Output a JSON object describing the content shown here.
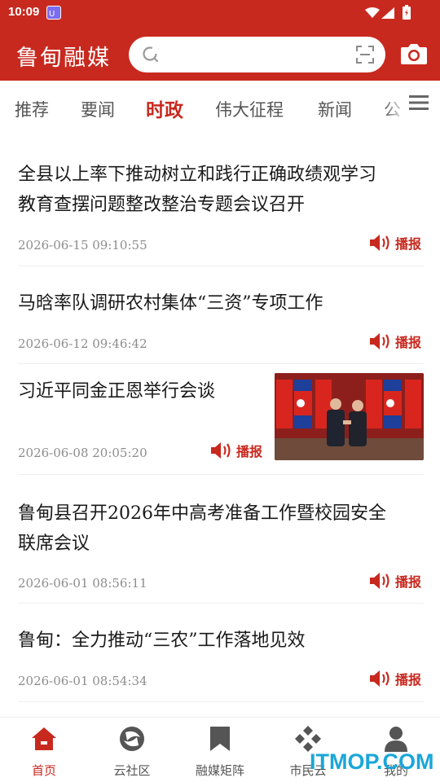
{
  "status_bar": {
    "time": "10:09"
  },
  "header": {
    "brand": "鲁甸融媒",
    "search_placeholder": ""
  },
  "tabs": [
    {
      "label": "推荐",
      "active": false
    },
    {
      "label": "要闻",
      "active": false
    },
    {
      "label": "时政",
      "active": true
    },
    {
      "label": "伟大征程",
      "active": false
    },
    {
      "label": "新闻",
      "active": false
    },
    {
      "label": "公",
      "active": false
    }
  ],
  "news": [
    {
      "title_line1": "全县以上率下推动树立和践行正确政绩观学习",
      "title_line2": "教育查摆问题整改整治专题会议召开",
      "date": "2026-06-15 09:10:55",
      "play_label": "播报"
    },
    {
      "title_line1": "马晗率队调研农村集体“三资”专项工作",
      "date": "2026-06-12 09:46:42",
      "play_label": "播报"
    },
    {
      "title_line1": "习近平同金正恩举行会谈",
      "date": "2026-06-08 20:05:20",
      "play_label": "播报"
    },
    {
      "title_line1": "鲁甸县召开2026年中高考准备工作暨校园安全",
      "title_line2": "联席会议",
      "date": "2026-06-01 08:56:11",
      "play_label": "播报"
    },
    {
      "title_line1": "鲁甸：全力推动“三农”工作落地见效",
      "date": "2026-06-01 08:54:34",
      "play_label": "播报"
    }
  ],
  "bottom_nav": [
    {
      "label": "首页",
      "icon": "home-icon",
      "active": true
    },
    {
      "label": "云社区",
      "icon": "community-icon",
      "active": false
    },
    {
      "label": "融媒矩阵",
      "icon": "bookmark-icon",
      "active": false
    },
    {
      "label": "市民云",
      "icon": "citizen-cloud-icon",
      "active": false
    },
    {
      "label": "我的",
      "icon": "user-icon",
      "active": false
    }
  ],
  "watermark": "ITMOP.COM",
  "colors": {
    "brand_red": "#c8291f",
    "watermark_blue": "#1aa6d8"
  }
}
